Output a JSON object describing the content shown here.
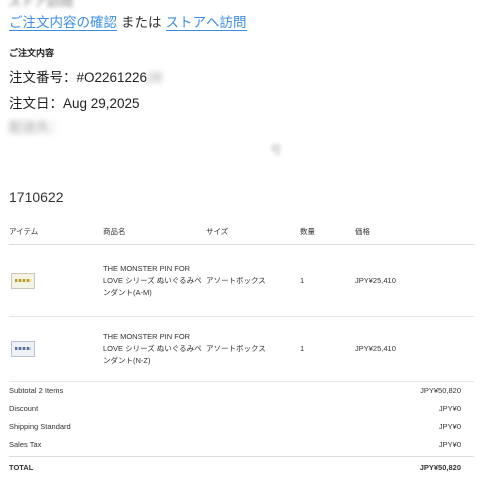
{
  "header": {
    "cut_line": "ストア訪問",
    "order_link": "ご注文内容の確認",
    "or_text": "または",
    "store_link": "ストアへ訪問"
  },
  "order": {
    "section_title": "ご注文内容",
    "number_label": "注文番号：",
    "number_value": "#O2261226",
    "number_blur": "28",
    "date_label": "注文日：",
    "date_value": "Aug 29,2025",
    "shipping_blur": "配送先：",
    "faint_char": "号",
    "id_number": "1710622"
  },
  "table": {
    "headers": [
      "アイテム",
      "商品名",
      "サイズ",
      "数量",
      "価格"
    ],
    "rows": [
      {
        "thumb_icon": "product-thumbnail-gold",
        "name": "THE MONSTER PIN FOR LOVE シリーズ ぬいぐるみペンダント(A-M)",
        "size": "アソートボックス",
        "qty": "1",
        "price": "JPY¥25,410"
      },
      {
        "thumb_icon": "product-thumbnail-blue",
        "name": "THE MONSTER PIN FOR LOVE シリーズ ぬいぐるみペンダント(N-Z)",
        "size": "アソートボックス",
        "qty": "1",
        "price": "JPY¥25,410"
      }
    ]
  },
  "totals": [
    {
      "label": "Subtotal 2 Items",
      "value": "JPY¥50,820"
    },
    {
      "label": "Discount",
      "value": "JPY¥0"
    },
    {
      "label": "Shipping Standard",
      "value": "JPY¥0"
    },
    {
      "label": "Sales Tax",
      "value": "JPY¥0"
    }
  ],
  "grand_total": {
    "label": "TOTAL",
    "value": "JPY¥50,820"
  },
  "colors": {
    "link": "#3a8ee6",
    "text": "#222222",
    "rule": "#dddddd"
  }
}
